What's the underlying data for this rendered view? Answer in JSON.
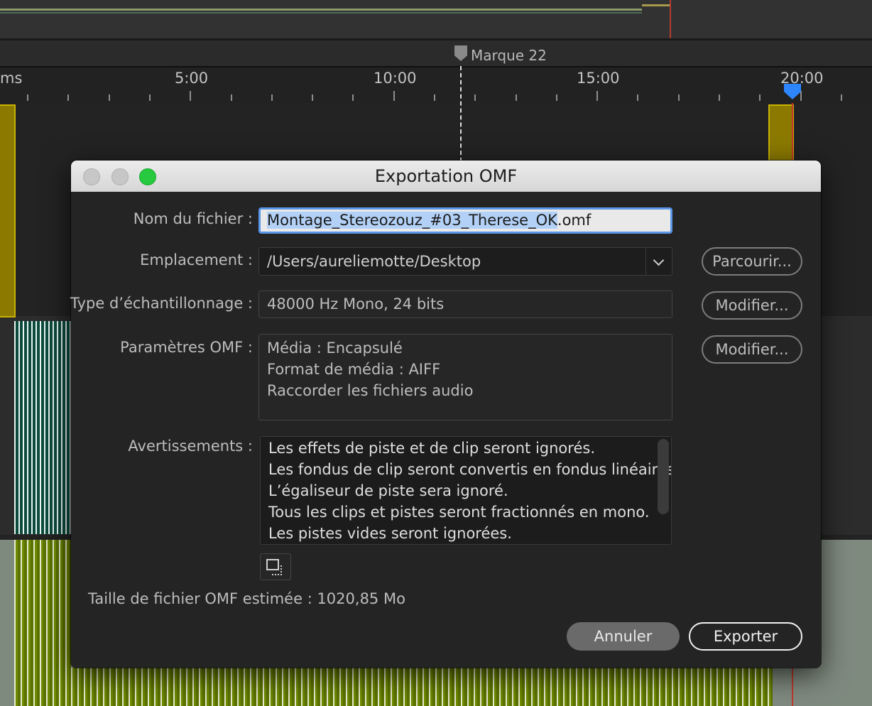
{
  "timeline": {
    "marker_label": "Marque 22",
    "ruler_labels": [
      "ms",
      "5:00",
      "10:00",
      "15:00",
      "20:00"
    ]
  },
  "dialog": {
    "title": "Exportation OMF",
    "filename": {
      "label": "Nom du fichier :",
      "value_selected": "Montage_Stereozouz_#03_Therese_OK",
      "value_suffix": ".omf"
    },
    "location": {
      "label": "Emplacement :",
      "value": "/Users/aureliemotte/Desktop",
      "browse_label": "Parcourir..."
    },
    "sampling": {
      "label": "Type d’échantillonnage :",
      "value": "48000 Hz Mono, 24 bits",
      "modify_label": "Modifier..."
    },
    "omf_params": {
      "label": "Paramètres OMF :",
      "lines": [
        "Média : Encapsulé",
        "Format de média : AIFF",
        "Raccorder les fichiers audio"
      ],
      "modify_label": "Modifier..."
    },
    "warnings": {
      "label": "Avertissements :",
      "lines": [
        "Les effets de piste et de clip seront ignorés.",
        "Les fondus de clip seront convertis en fondus linéaires.",
        "L’égaliseur de piste sera ignoré.",
        "Tous les clips et pistes seront fractionnés en mono.",
        "Les pistes vides seront ignorées."
      ]
    },
    "estimated_size": "Taille de fichier OMF estimée : 1020,85 Mo",
    "cancel_label": "Annuler",
    "export_label": "Exporter"
  }
}
